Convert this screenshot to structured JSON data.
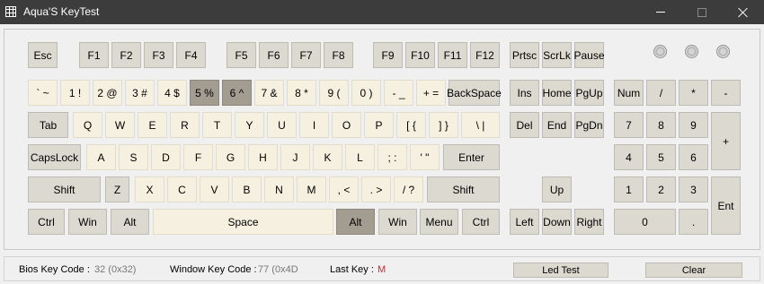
{
  "window": {
    "title": "Aqua'S KeyTest"
  },
  "status": {
    "bios_label": "Bios Key Code :",
    "bios_value": "32 (0x32)",
    "window_label": "Window Key Code :",
    "window_value": "77 (0x4D",
    "last_label": "Last Key :",
    "last_value": "M",
    "led_button": "Led Test",
    "clear_button": "Clear"
  },
  "keys": {
    "esc": "Esc",
    "f1": "F1",
    "f2": "F2",
    "f3": "F3",
    "f4": "F4",
    "f5": "F5",
    "f6": "F6",
    "f7": "F7",
    "f8": "F8",
    "f9": "F9",
    "f10": "F10",
    "f11": "F11",
    "f12": "F12",
    "prtsc": "Prtsc",
    "scrlk": "ScrLk",
    "pause": "Pause",
    "grave": "` ~",
    "d1": "1 !",
    "d2": "2 @",
    "d3": "3 #",
    "d4": "4 $",
    "d5": "5 %",
    "d6": "6 ^",
    "d7": "7 &",
    "d8": "8 *",
    "d9": "9 (",
    "d0": "0 )",
    "minus": "- _",
    "equal": "+ =",
    "backspace": "BackSpace",
    "ins": "Ins",
    "home": "Home",
    "pgup": "PgUp",
    "num": "Num",
    "np_div": "/",
    "np_mul": "*",
    "np_sub": "-",
    "tab": "Tab",
    "q": "Q",
    "w": "W",
    "e": "E",
    "r": "R",
    "t": "T",
    "y": "Y",
    "u": "U",
    "i": "I",
    "o": "O",
    "p": "P",
    "lbracket": "[ {",
    "rbracket": "] }",
    "backslash": "\\ |",
    "del": "Del",
    "end": "End",
    "pgdn": "PgDn",
    "np7": "7",
    "np8": "8",
    "np9": "9",
    "np_add": "+",
    "capslock": "CapsLock",
    "a": "A",
    "s": "S",
    "d": "D",
    "f": "F",
    "g": "G",
    "h": "H",
    "j": "J",
    "k": "K",
    "l": "L",
    "semicolon": "; :",
    "quote": "' \"",
    "enter": "Enter",
    "np4": "4",
    "np5": "5",
    "np6": "6",
    "lshift": "Shift",
    "z": "Z",
    "x": "X",
    "c": "C",
    "v": "V",
    "b": "B",
    "n": "N",
    "m": "M",
    "comma": ", <",
    "period": ". >",
    "slash": "/ ?",
    "rshift": "Shift",
    "up": "Up",
    "np1": "1",
    "np2": "2",
    "np3": "3",
    "np_enter": "Ent",
    "lctrl": "Ctrl",
    "lwin": "Win",
    "lalt": "Alt",
    "space": "Space",
    "ralt": "Alt",
    "rwin": "Win",
    "menu": "Menu",
    "rctrl": "Ctrl",
    "left": "Left",
    "down": "Down",
    "right": "Right",
    "np0": "0",
    "np_dot": "."
  },
  "pressed_keys": [
    "d5",
    "d6",
    "ralt"
  ],
  "colors": {
    "key_default": "#dcdad0",
    "key_tested": "#f6f0e0",
    "key_pressed": "#a39d91",
    "last_key": "#e02020"
  }
}
